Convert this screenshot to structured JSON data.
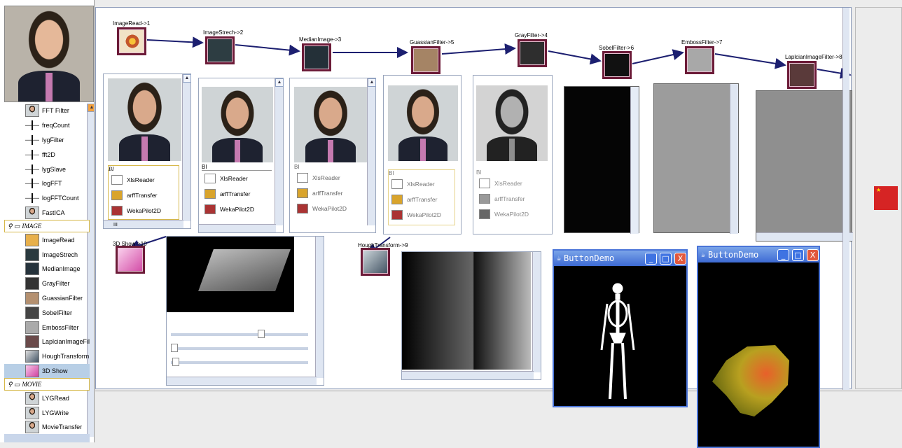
{
  "sidebar": {
    "items_top": [
      {
        "label": "FFT Filter",
        "icon": "face-thumb-icon"
      },
      {
        "label": "freqCount",
        "icon": "waveform-icon"
      },
      {
        "label": "lygFilter",
        "icon": "waveform-icon"
      },
      {
        "label": "fft2D",
        "icon": "waveform-icon"
      },
      {
        "label": "lygSlave",
        "icon": "waveform-icon"
      },
      {
        "label": "logFFT",
        "icon": "waveform-icon"
      },
      {
        "label": "logFFTCount",
        "icon": "waveform-icon"
      },
      {
        "label": "FastICA",
        "icon": "face-thumb-icon"
      }
    ],
    "group_image": "IMAGE",
    "items_image": [
      {
        "label": "ImageRead"
      },
      {
        "label": "ImageStrech"
      },
      {
        "label": "MedianImage"
      },
      {
        "label": "GrayFilter"
      },
      {
        "label": "GuassianFilter"
      },
      {
        "label": "SobelFilter"
      },
      {
        "label": "EmbossFilter"
      },
      {
        "label": "LaplcianImageFil"
      },
      {
        "label": "HoughTransform"
      },
      {
        "label": "3D Show"
      }
    ],
    "group_movie": "MOVIE",
    "items_movie": [
      {
        "label": "LYGRead"
      },
      {
        "label": "LYGWrite"
      },
      {
        "label": "MovieTransfer"
      }
    ]
  },
  "nodes": {
    "n1": "ImageRead->1",
    "n2": "ImageStrech->2",
    "n3": "MedianImage->3",
    "n4": "GuassianFilter->5",
    "n5": "GrayFilter->4",
    "n6": "SobelFilter->6",
    "n7": "EmbossFilter->7",
    "n8": "LaplcianImageFilter->8",
    "n9": "3D Show->10",
    "n10": "HoughTransform->9"
  },
  "panels": {
    "group_label": "BI",
    "tools": [
      "XlsReader",
      "arffTransfer",
      "WekaPilot2D"
    ],
    "scroll_glyph": "III"
  },
  "windows": {
    "w1_title": "ButtonDemo",
    "w2_title": "ButtonDemo",
    "minimize": "_",
    "maximize": "□",
    "close": "X"
  },
  "colors": {
    "node_border": "#6c1b38",
    "edge": "#1c1f70",
    "title_bar": "#3d6ad4",
    "flag": "#d62424"
  }
}
